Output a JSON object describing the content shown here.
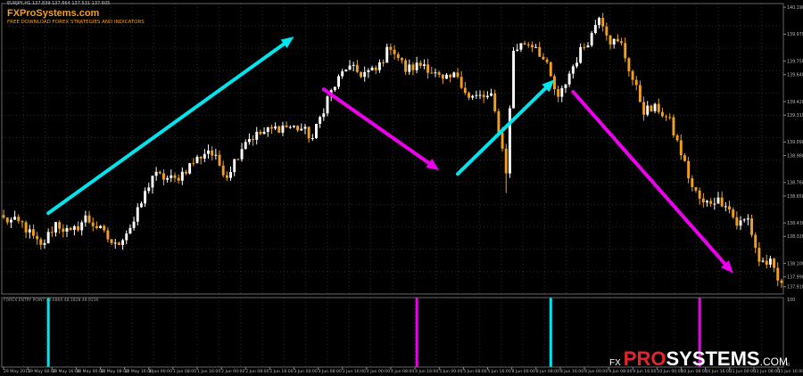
{
  "header": {
    "symbol_info": "EURJPY,H1  137.839 137.664 137.531 137.605",
    "logo_text": "FXProSystems.com",
    "tagline": "FREE DOWNLOAD FOREX STRATEGIES AND INDICATORS"
  },
  "indicator": {
    "label": "FOREX ENTRY POINT 48.6860 48.1828 48.9236",
    "levels": [
      "100",
      "0"
    ],
    "signals": [
      {
        "type": "buy",
        "color": "#00e5ee",
        "bar": 12
      },
      {
        "type": "sell",
        "color": "#ee00ee",
        "bar": 111
      },
      {
        "type": "buy",
        "color": "#00e5ee",
        "bar": 147
      },
      {
        "type": "sell",
        "color": "#ee00ee",
        "bar": 187
      }
    ]
  },
  "watermark": {
    "fx": "FX",
    "pro": "PRO",
    "systems": "SYSTEMS",
    "com": ".COM"
  },
  "colors": {
    "bull": "#ffffff",
    "bear": "#f0a020",
    "grid": "#2e2e2e",
    "buy_arrow": "#00e5ee",
    "sell_arrow": "#ee00ee"
  },
  "chart_data": {
    "type": "candlestick",
    "symbol": "EURJPY",
    "timeframe": "H1",
    "y_ticks": [
      "140.190",
      "139.970",
      "139.750",
      "139.640",
      "139.420",
      "139.310",
      "139.090",
      "138.980",
      "138.760",
      "138.650",
      "138.430",
      "138.320",
      "138.100",
      "137.990",
      "137.910"
    ],
    "y_tick_values": [
      140.19,
      139.97,
      139.75,
      139.64,
      139.42,
      139.31,
      139.09,
      138.98,
      138.76,
      138.65,
      138.43,
      138.32,
      138.1,
      137.99,
      137.91
    ],
    "x_labels": [
      "29 May 2015",
      "29 May 08:00",
      "29 May 16:00",
      "30 May 00:00",
      "30 May 08:00",
      "30 May 16:00",
      "1 Jun 00:00",
      "1 Jun 08:00",
      "1 Jun 16:00",
      "2 Jun 00:00",
      "2 Jun 08:00",
      "2 Jun 16:00",
      "3 Jun 00:00",
      "3 Jun 08:00",
      "3 Jun 16:00",
      "4 Jun 00:00",
      "4 Jun 08:00",
      "4 Jun 16:00",
      "5 Jun 00:00",
      "5 Jun 08:00",
      "5 Jun 16:00",
      "8 Jun 00:00",
      "8 Jun 08:00",
      "8 Jun 16:00",
      "9 Jun 00:00",
      "9 Jun 08:00",
      "9 Jun 16:00",
      "10 Jun 00:00",
      "10 Jun 08:00",
      "10 Jun 16:00",
      "11 Jun 00:00",
      "11 Jun 08:00",
      "11 Jun 16:00"
    ],
    "keypoints": [
      [
        0,
        138.46
      ],
      [
        5,
        138.42
      ],
      [
        10,
        138.23
      ],
      [
        14,
        138.43
      ],
      [
        18,
        138.34
      ],
      [
        22,
        138.47
      ],
      [
        25,
        138.4
      ],
      [
        30,
        138.24
      ],
      [
        35,
        138.44
      ],
      [
        40,
        138.82
      ],
      [
        46,
        138.78
      ],
      [
        50,
        138.9
      ],
      [
        55,
        139.03
      ],
      [
        60,
        138.82
      ],
      [
        65,
        139.11
      ],
      [
        70,
        139.17
      ],
      [
        75,
        139.22
      ],
      [
        80,
        139.2
      ],
      [
        83,
        139.12
      ],
      [
        87,
        139.45
      ],
      [
        92,
        139.7
      ],
      [
        96,
        139.65
      ],
      [
        100,
        139.67
      ],
      [
        104,
        139.88
      ],
      [
        108,
        139.68
      ],
      [
        113,
        139.73
      ],
      [
        118,
        139.58
      ],
      [
        122,
        139.64
      ],
      [
        125,
        139.45
      ],
      [
        128,
        139.46
      ],
      [
        131,
        139.45
      ],
      [
        133,
        139.2
      ],
      [
        135,
        138.86
      ],
      [
        137,
        139.84
      ],
      [
        140,
        139.9
      ],
      [
        143,
        139.88
      ],
      [
        146,
        139.7
      ],
      [
        149,
        139.43
      ],
      [
        152,
        139.65
      ],
      [
        155,
        139.83
      ],
      [
        158,
        139.97
      ],
      [
        160,
        140.14
      ],
      [
        163,
        139.92
      ],
      [
        166,
        139.88
      ],
      [
        169,
        139.6
      ],
      [
        172,
        139.35
      ],
      [
        176,
        139.36
      ],
      [
        179,
        139.25
      ],
      [
        182,
        139.0
      ],
      [
        185,
        138.72
      ],
      [
        188,
        138.58
      ],
      [
        191,
        138.62
      ],
      [
        194,
        138.6
      ],
      [
        197,
        138.42
      ],
      [
        200,
        138.46
      ],
      [
        203,
        138.12
      ],
      [
        206,
        138.1
      ],
      [
        208,
        137.95
      ]
    ],
    "arrows": [
      {
        "type": "buy",
        "from": [
          12,
          138.51
        ],
        "to": [
          78,
          139.95
        ]
      },
      {
        "type": "sell",
        "from": [
          86,
          139.52
        ],
        "to": [
          117,
          138.86
        ]
      },
      {
        "type": "buy",
        "from": [
          122,
          138.83
        ],
        "to": [
          148,
          139.6
        ]
      },
      {
        "type": "sell",
        "from": [
          153,
          139.5
        ],
        "to": [
          196,
          138.02
        ]
      }
    ],
    "ylim": [
      137.85,
      140.22
    ],
    "bars": 210
  }
}
